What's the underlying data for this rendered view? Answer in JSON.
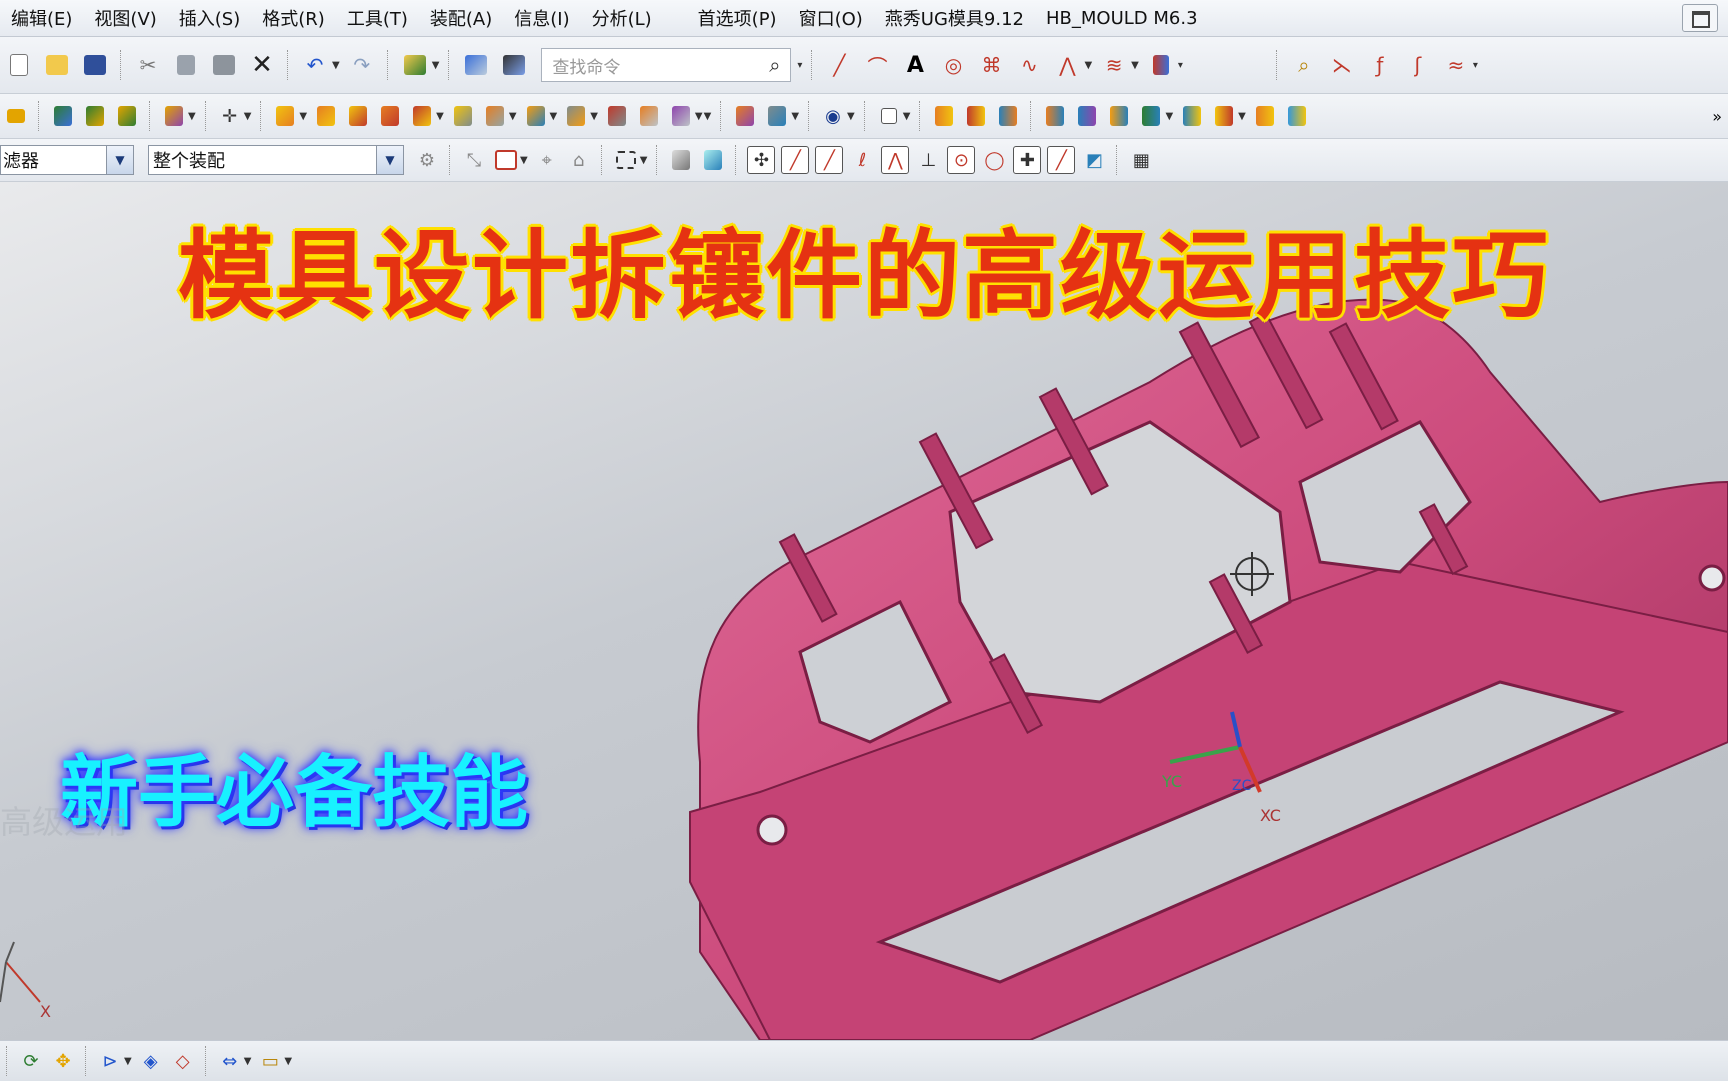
{
  "menu": [
    "编辑(E)",
    "视图(V)",
    "插入(S)",
    "格式(R)",
    "工具(T)",
    "装配(A)",
    "信息(I)",
    "分析(L)"
  ],
  "menu_right": [
    "首选项(P)",
    "窗口(O)",
    "燕秀UG模具9.12",
    "HB_MOULD M6.3"
  ],
  "search": {
    "placeholder": "查找命令"
  },
  "filter": {
    "type_value": "滤器",
    "scope_value": "整个装配"
  },
  "overlay": {
    "title": "模具设计拆镶件的高级运用技巧",
    "subtitle": "新手必备技能",
    "ghost_text": "高级运用"
  },
  "axes": {
    "xc": "XC",
    "yc": "YC",
    "zc": "ZC",
    "x": "X"
  },
  "colors": {
    "part": "#cc4b7c",
    "part_dark": "#8e2750",
    "title_fill": "#e53212",
    "title_outline": "#ffe000",
    "subtitle": "#18f1ff"
  },
  "icons": {
    "toolbar1": [
      "new-icon",
      "open-icon",
      "save-icon",
      "cut-icon",
      "copy-icon",
      "paste-icon",
      "delete-icon",
      "undo-icon",
      "redo-icon",
      "repeat-icon",
      "edit-object-icon",
      "display-icon"
    ],
    "toolbar1_right": [
      "line-icon",
      "arc-icon",
      "text-icon",
      "circle-icon",
      "sketch-icon",
      "curve-icon",
      "spline-icon",
      "offset-icon",
      "bridge-icon"
    ]
  }
}
